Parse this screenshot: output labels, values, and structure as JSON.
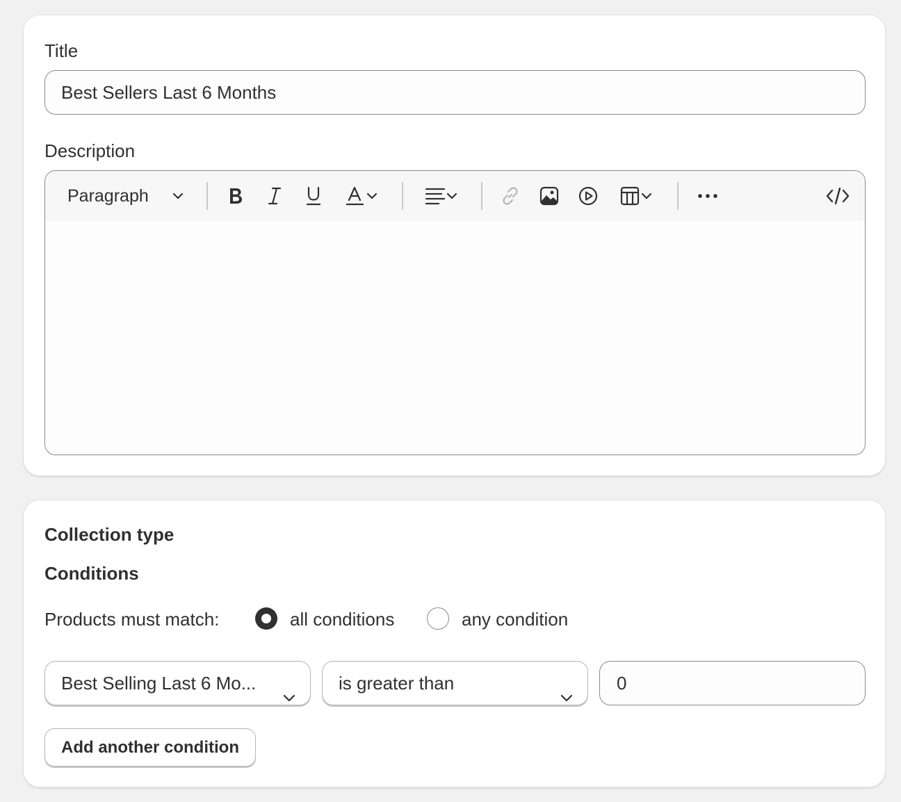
{
  "general": {
    "title_label": "Title",
    "title_value": "Best Sellers Last 6 Months",
    "description_label": "Description",
    "description_value": ""
  },
  "toolbar": {
    "paragraph_label": "Paragraph",
    "icons": [
      "chevron-down-icon",
      "bold-icon",
      "italic-icon",
      "underline-icon",
      "text-color-icon",
      "align-icon",
      "link-icon",
      "image-icon",
      "video-icon",
      "table-icon",
      "more-icon",
      "code-icon"
    ],
    "link_disabled_color": "#b5b5b5"
  },
  "collection": {
    "heading": "Collection type",
    "conditions_heading": "Conditions",
    "match_label": "Products must match:",
    "options": [
      {
        "label": "all conditions",
        "checked": true
      },
      {
        "label": "any condition",
        "checked": false
      }
    ],
    "condition": {
      "field": "Best Selling Last 6 Mo...",
      "operator": "is greater than",
      "value": "0"
    },
    "add_button": "Add another condition"
  }
}
